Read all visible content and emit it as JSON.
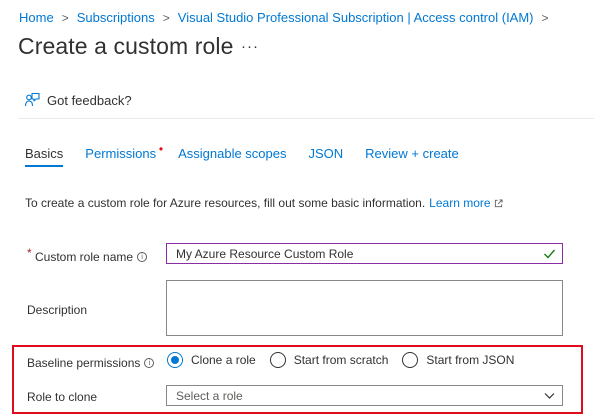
{
  "breadcrumb": {
    "items": [
      "Home",
      "Subscriptions",
      "Visual Studio Professional Subscription | Access control (IAM)"
    ],
    "separator": ">"
  },
  "page": {
    "title": "Create a custom role",
    "more_label": "···"
  },
  "toolbar": {
    "feedback_label": "Got feedback?"
  },
  "tabs": [
    {
      "label": "Basics",
      "active": true
    },
    {
      "label": "Permissions",
      "required_marker": "•"
    },
    {
      "label": "Assignable scopes"
    },
    {
      "label": "JSON"
    },
    {
      "label": "Review + create"
    }
  ],
  "intro": {
    "text": "To create a custom role for Azure resources, fill out some basic information.",
    "link": "Learn more"
  },
  "form": {
    "role_name": {
      "required_marker": "*",
      "label": "Custom role name",
      "value": "My Azure Resource Custom Role"
    },
    "description": {
      "label": "Description",
      "value": ""
    },
    "baseline": {
      "label": "Baseline permissions",
      "options": [
        "Clone a role",
        "Start from scratch",
        "Start from JSON"
      ],
      "selected": "Clone a role"
    },
    "role_to_clone": {
      "label": "Role to clone",
      "placeholder": "Select a role"
    }
  },
  "colors": {
    "link": "#0078d4",
    "text": "#323130",
    "focus_border": "#8a2da5",
    "highlight_border": "#e00b1c",
    "success_check": "#107c10"
  }
}
